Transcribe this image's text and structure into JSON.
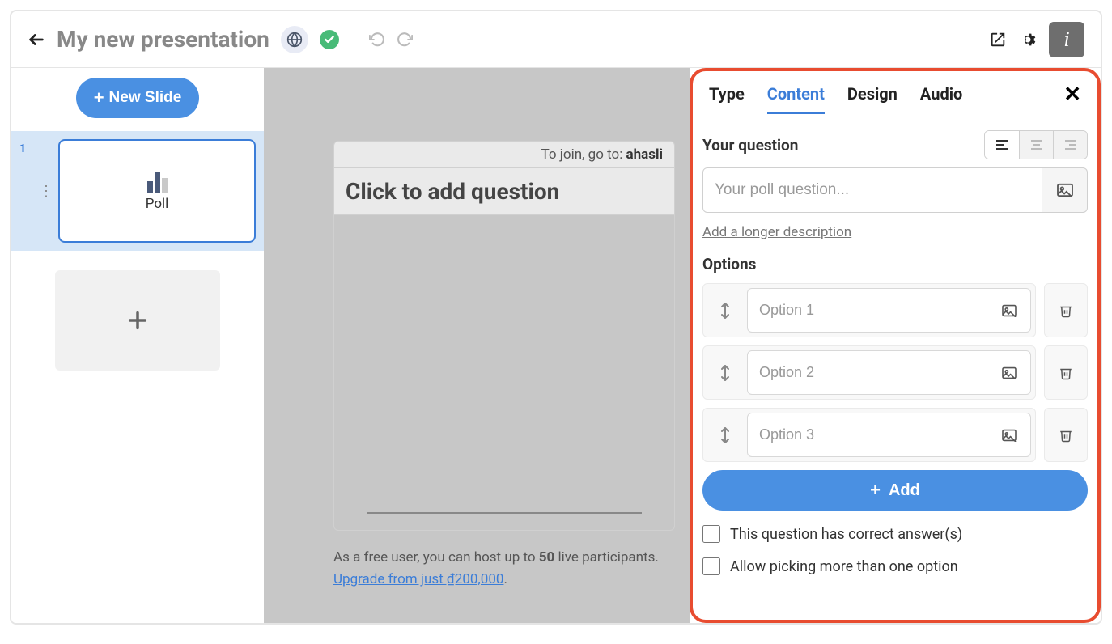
{
  "topbar": {
    "title": "My new presentation"
  },
  "sidebar": {
    "new_slide_label": "New Slide",
    "slides": [
      {
        "num": "1",
        "label": "Poll"
      }
    ]
  },
  "canvas": {
    "join_prefix": "To join, go to: ",
    "join_domain": "ahasli",
    "question_placeholder": "Click to add question",
    "footer_p1": "As a free user, you can host up to ",
    "footer_bold": "50",
    "footer_p2": " live participants.  ",
    "footer_link": "Upgrade from just ₫200,000",
    "footer_p3": "."
  },
  "panel": {
    "tabs": {
      "type": "Type",
      "content": "Content",
      "design": "Design",
      "audio": "Audio"
    },
    "question_label": "Your question",
    "question_placeholder": "Your poll question...",
    "desc_link": "Add a longer description",
    "options_label": "Options",
    "options": [
      {
        "placeholder": "Option 1"
      },
      {
        "placeholder": "Option 2"
      },
      {
        "placeholder": "Option 3"
      }
    ],
    "add_label": "Add",
    "cb_correct": "This question has correct answer(s)",
    "cb_multi": "Allow picking more than one option"
  }
}
